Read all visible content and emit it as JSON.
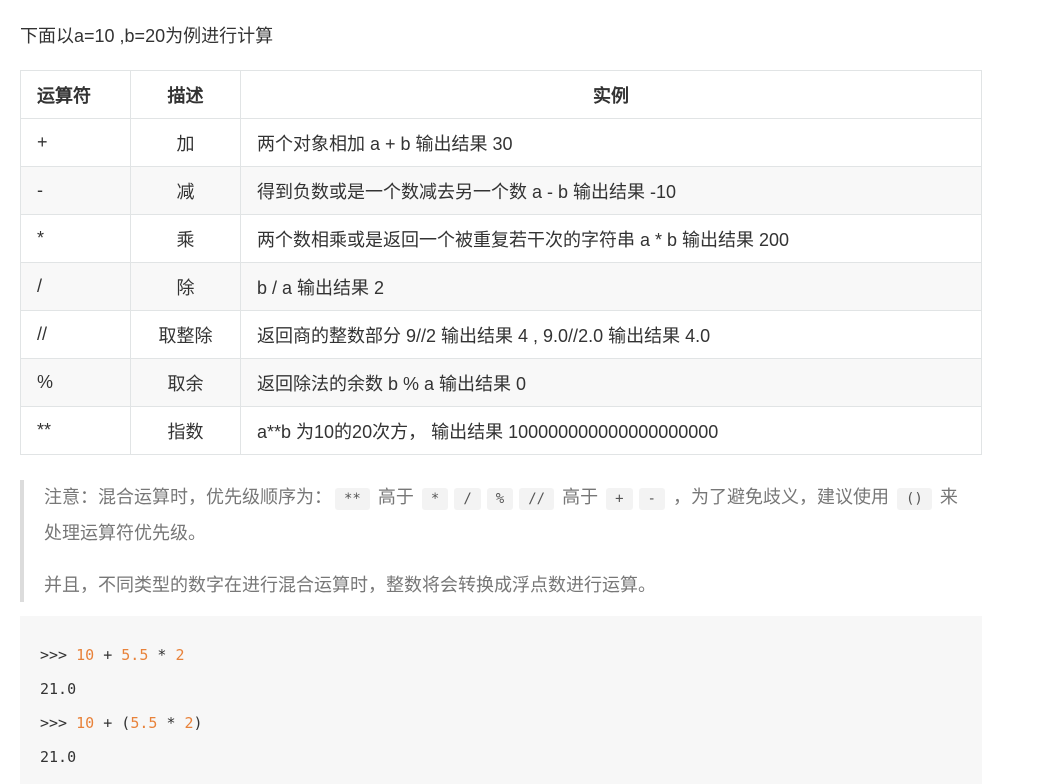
{
  "intro": "下面以a=10 ,b=20为例进行计算",
  "table": {
    "headers": [
      "运算符",
      "描述",
      "实例"
    ],
    "rows": [
      {
        "op": "+",
        "desc": "加",
        "example": "两个对象相加 a + b 输出结果 30"
      },
      {
        "op": "-",
        "desc": "减",
        "example": "得到负数或是一个数减去另一个数 a - b 输出结果 -10"
      },
      {
        "op": "*",
        "desc": "乘",
        "example": "两个数相乘或是返回一个被重复若干次的字符串 a * b 输出结果 200"
      },
      {
        "op": "/",
        "desc": "除",
        "example": "b / a 输出结果 2"
      },
      {
        "op": "//",
        "desc": "取整除",
        "example": "返回商的整数部分 9//2 输出结果 4 , 9.0//2.0 输出结果 4.0"
      },
      {
        "op": "%",
        "desc": "取余",
        "example": "返回除法的余数 b % a 输出结果 0"
      },
      {
        "op": "**",
        "desc": "指数",
        "example": "a**b 为10的20次方， 输出结果 100000000000000000000"
      }
    ]
  },
  "note": {
    "p1_a": "注意：混合运算时，优先级顺序为：",
    "code_pow": "**",
    "p1_b": "高于",
    "code_mul": "*",
    "code_div": "/",
    "code_mod": "%",
    "code_floordiv": "//",
    "p1_c": "高于",
    "code_add": "+",
    "code_sub": "-",
    "p1_d": "，为了避免歧义，建议使用",
    "code_paren": "()",
    "p1_e": "来处理运算符优先级。",
    "p2": "并且，不同类型的数字在进行混合运算时，整数将会转换成浮点数进行运算。"
  },
  "code": {
    "prompt": ">>>",
    "l1": {
      "a": "10",
      "op1": "+",
      "b": "5.5",
      "op2": "*",
      "c": "2"
    },
    "o1": "21.0",
    "l3": {
      "a": "10",
      "op1": "+",
      "lp": "(",
      "b": "5.5",
      "op2": "*",
      "c": "2",
      "rp": ")"
    },
    "o2": "21.0"
  }
}
